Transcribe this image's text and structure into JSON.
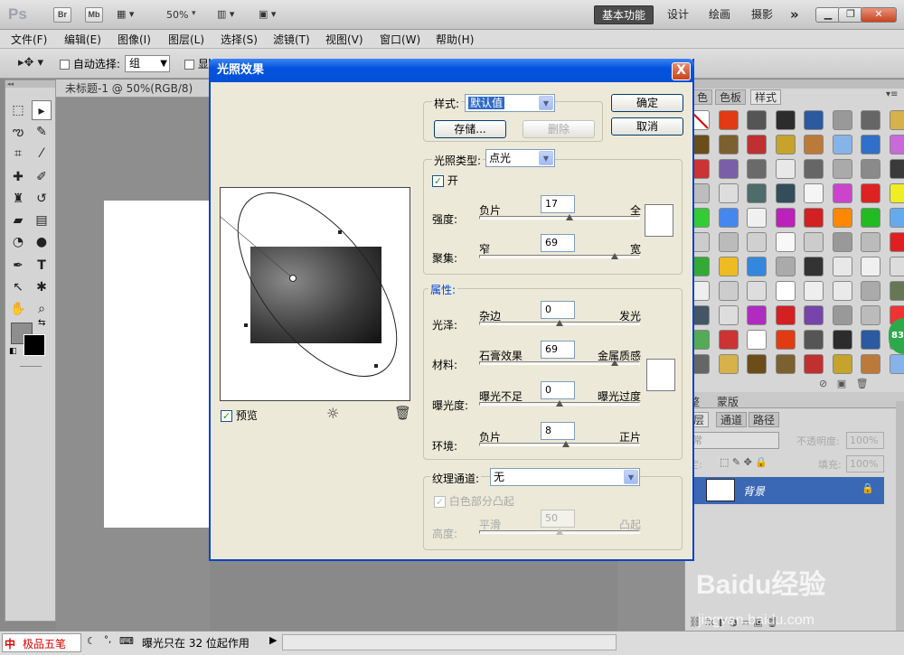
{
  "app": {
    "logo": "Ps",
    "bridge": "Br",
    "minibridge": "Mb",
    "zoom": "50%",
    "workspaces": [
      "基本功能",
      "设计",
      "绘画",
      "摄影"
    ],
    "more": "»"
  },
  "menu": [
    "文件(F)",
    "编辑(E)",
    "图像(I)",
    "图层(L)",
    "选择(S)",
    "滤镜(T)",
    "视图(V)",
    "窗口(W)",
    "帮助(H)"
  ],
  "options": {
    "auto_select": "自动选择:",
    "group_value": "组",
    "show": "显"
  },
  "doc_tab": "未标题-1 @ 50%(RGB/8)",
  "panels": {
    "tabs": [
      "色",
      "色板",
      "样式"
    ],
    "layer_tabs": [
      "层",
      "通道",
      "路径"
    ],
    "blend": "常",
    "opacity_label": "不透明度:",
    "opacity": "100%",
    "fill_label": "填充:",
    "fill": "100%",
    "lock_label": "定:",
    "layer_name": "背景",
    "badge": "83"
  },
  "status": {
    "ime": "极品五笔",
    "message": "曝光只在 32 位起作用"
  },
  "dialog": {
    "title": "光照效果",
    "close": "X",
    "ok": "确定",
    "cancel": "取消",
    "style_label": "样式:",
    "style_value": "默认值",
    "save": "存储...",
    "delete": "删除",
    "light_type_label": "光照类型:",
    "light_type_value": "点光",
    "on_label": "开",
    "preview_label": "预览",
    "intensity": {
      "label": "强度:",
      "left": "负片",
      "right": "全",
      "value": "17",
      "pos": 0.56
    },
    "focus": {
      "label": "聚集:",
      "left": "窄",
      "right": "宽",
      "value": "69",
      "pos": 0.84
    },
    "props_legend": "属性:",
    "gloss": {
      "label": "光泽:",
      "left": "杂边",
      "right": "发光",
      "value": "0",
      "pos": 0.5
    },
    "material": {
      "label": "材料:",
      "left": "石膏效果",
      "right": "金属质感",
      "value": "69",
      "pos": 0.84
    },
    "exposure": {
      "label": "曝光度:",
      "left": "曝光不足",
      "right": "曝光过度",
      "value": "0",
      "pos": 0.5
    },
    "ambience": {
      "label": "环境:",
      "left": "负片",
      "right": "正片",
      "value": "8",
      "pos": 0.54
    },
    "texture_label": "纹理通道:",
    "texture_value": "无",
    "white_high": "白色部分凸起",
    "height": {
      "label": "高度:",
      "left": "平滑",
      "right": "凸起",
      "value": "50",
      "pos": 0.5
    }
  },
  "watermark": {
    "brand": "Baidu经验",
    "url": "jingyan.baidu.com"
  },
  "colors": {
    "title_bar": "#0453de",
    "accent": "#3a68b4"
  }
}
